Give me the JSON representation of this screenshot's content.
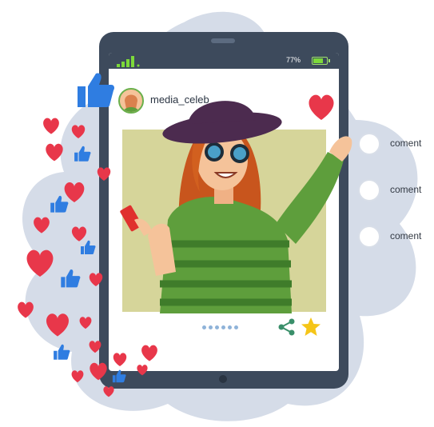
{
  "status_bar": {
    "battery_label": "77%",
    "battery_level": 0.77,
    "signal_bars": 4
  },
  "post": {
    "username": "media_celeb",
    "carousel_dots": 6
  },
  "comments": [
    {
      "label": "coment"
    },
    {
      "label": "coment"
    },
    {
      "label": "coment"
    }
  ],
  "colors": {
    "tablet_frame": "#3d4a5c",
    "heart": "#e8374a",
    "like": "#2f7de1",
    "blob": "#d5dce8",
    "photo_bg": "#d6d59a",
    "share": "#3a8f6a",
    "star": "#f5c518"
  },
  "icons": [
    "like-thumb-icon",
    "heart-icon",
    "share-icon",
    "star-icon",
    "signal-icon",
    "battery-icon"
  ]
}
